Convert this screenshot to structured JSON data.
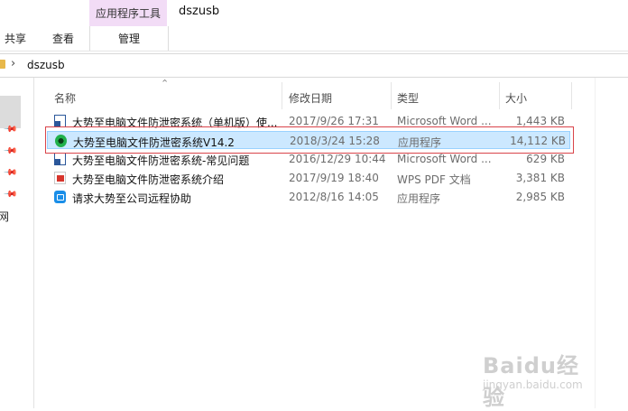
{
  "ribbon": {
    "tabs": [
      "共享",
      "查看"
    ],
    "context_group_label": "应用程序工具",
    "context_tab": "管理",
    "context_color": "#f2dcf6"
  },
  "window": {
    "title": "dszusb"
  },
  "address": {
    "breadcrumb": "dszusb"
  },
  "nav": {
    "item_label": "网"
  },
  "columns": {
    "name": "名称",
    "date": "修改日期",
    "type": "类型",
    "size": "大小"
  },
  "files": [
    {
      "name": "大势至电脑文件防泄密系统（单机版）使...",
      "date": "2017/9/26 17:31",
      "type": "Microsoft Word ...",
      "size": "1,443 KB",
      "icon": "word-doc-icon"
    },
    {
      "name": "大势至电脑文件防泄密系统V14.2",
      "date": "2018/3/24 15:28",
      "type": "应用程序",
      "size": "14,112 KB",
      "icon": "app-icon",
      "selected": true
    },
    {
      "name": "大势至电脑文件防泄密系统-常见问题",
      "date": "2016/12/29 10:44",
      "type": "Microsoft Word ...",
      "size": "629 KB",
      "icon": "word-doc-icon"
    },
    {
      "name": "大势至电脑文件防泄密系统介绍",
      "date": "2017/9/19 18:40",
      "type": "WPS PDF 文档",
      "size": "3,381 KB",
      "icon": "pdf-icon"
    },
    {
      "name": "请求大势至公司远程协助",
      "date": "2012/8/16 14:05",
      "type": "应用程序",
      "size": "2,985 KB",
      "icon": "remote-assist-icon"
    }
  ],
  "colors": {
    "selection": "#cce8ff",
    "selection_border": "#99d1ff",
    "annotation_red": "#d9444a"
  },
  "watermark": {
    "logo": "Baidu经验",
    "url": "jingyan.baidu.com"
  }
}
